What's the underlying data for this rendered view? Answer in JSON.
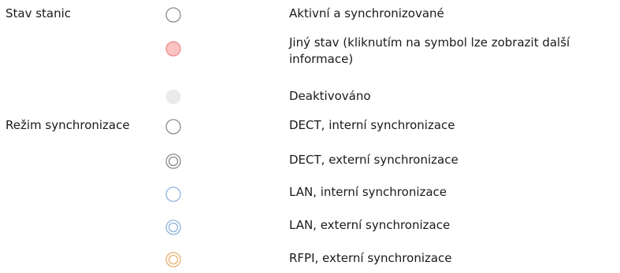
{
  "sections": {
    "station_status": "Stav stanic",
    "sync_mode": "Režim synchronizace"
  },
  "rows": [
    {
      "icon": "circle-outline-gray-icon",
      "text": "Aktivní a synchronizované"
    },
    {
      "icon": "circle-filled-red-icon",
      "text": "Jiný stav (kliknutím na symbol lze zobrazit další informace)"
    },
    {
      "icon": "circle-filled-lightgray-icon",
      "text": "Deaktivováno"
    },
    {
      "icon": "circle-outline-gray-icon",
      "text": "DECT, interní synchronizace"
    },
    {
      "icon": "double-circle-gray-icon",
      "text": "DECT, externí synchronizace"
    },
    {
      "icon": "circle-outline-blue-icon",
      "text": "LAN, interní synchronizace"
    },
    {
      "icon": "double-circle-blue-icon",
      "text": "LAN, externí synchronizace"
    },
    {
      "icon": "double-circle-orange-icon",
      "text": "RFPI, externí synchronizace"
    }
  ],
  "colors": {
    "gray": "#8a8a8a",
    "red_fill": "#fbc3c3",
    "red_stroke": "#ef8a8a",
    "light_gray": "#ebebeb",
    "blue": "#8fb3dc",
    "orange": "#e8b070"
  }
}
